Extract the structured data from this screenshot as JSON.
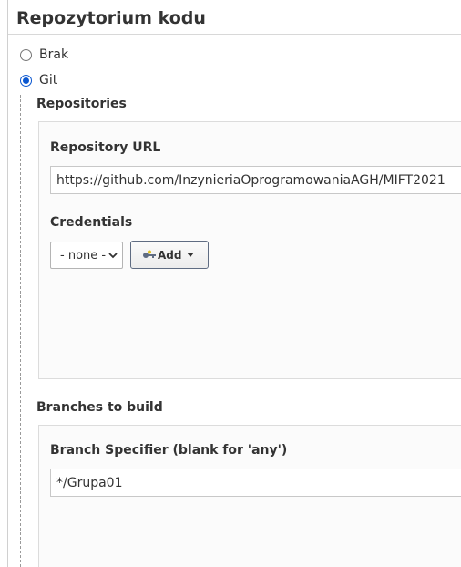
{
  "section": {
    "title": "Repozytorium kodu"
  },
  "scm_options": [
    {
      "label": "Brak",
      "selected": false
    },
    {
      "label": "Git",
      "selected": true
    }
  ],
  "repositories": {
    "heading": "Repositories",
    "url_label": "Repository URL",
    "url_value": "https://github.com/InzynieriaOprogramowaniaAGH/MIFT2021",
    "credentials_label": "Credentials",
    "credentials_selected": "- none -",
    "add_label": "Add"
  },
  "branches": {
    "heading": "Branches to build",
    "specifier_label": "Branch Specifier (blank for 'any')",
    "specifier_value": "*/Grupa01"
  },
  "colors": {
    "radio_accent": "#0b57d0",
    "text": "#333333",
    "panel_background": "#fbfbfb"
  }
}
